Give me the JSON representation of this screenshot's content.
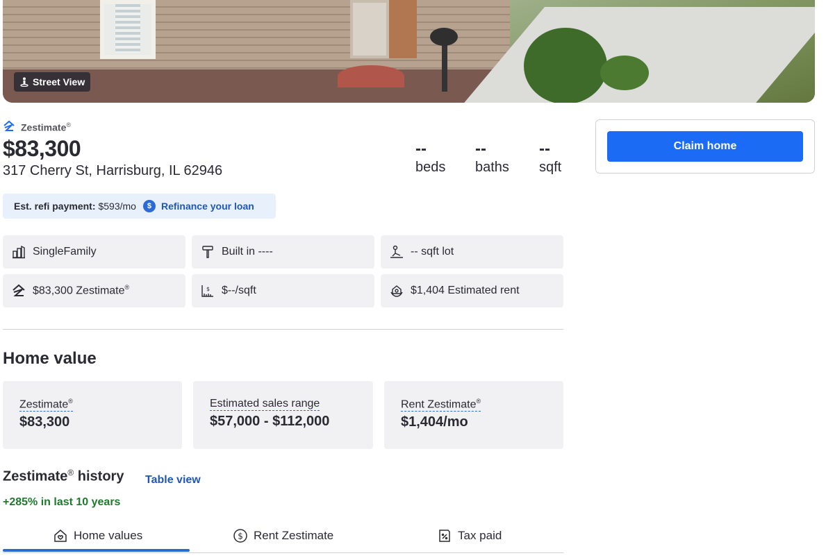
{
  "hero": {
    "street_view_label": "Street View"
  },
  "summary": {
    "zestimate_label": "Zestimate",
    "registered": "®",
    "price": "$83,300",
    "address": "317 Cherry St, Harrisburg, IL 62946",
    "stats": [
      {
        "value": "--",
        "label": "beds"
      },
      {
        "value": "--",
        "label": "baths"
      },
      {
        "value": "--",
        "label": "sqft"
      }
    ]
  },
  "refi": {
    "label": "Est. refi payment:",
    "value": "$593/mo",
    "icon_text": "$",
    "link": "Refinance your loan"
  },
  "facts": [
    {
      "icon": "building-icon",
      "text": "SingleFamily"
    },
    {
      "icon": "hammer-icon",
      "text": "Built in ----"
    },
    {
      "icon": "lot-icon",
      "text": "-- sqft lot"
    },
    {
      "icon": "zillow-logo-icon",
      "text": "$83,300 Zestimate",
      "sup": "®"
    },
    {
      "icon": "price-per-sqft-icon",
      "text": "$--/sqft"
    },
    {
      "icon": "rent-hand-icon",
      "text": "$1,404 Estimated rent"
    }
  ],
  "home_value": {
    "heading": "Home value",
    "cards": [
      {
        "title": "Zestimate",
        "sup": "®",
        "value": "$83,300"
      },
      {
        "title": "Estimated sales range",
        "sup": "",
        "value": "$57,000 - $112,000"
      },
      {
        "title": "Rent Zestimate",
        "sup": "®",
        "value": "$1,404/mo"
      }
    ]
  },
  "history": {
    "heading_prefix": "Zestimate",
    "sup": "®",
    "heading_suffix": " history",
    "table_view": "Table view",
    "growth": "+285% in last 10 years",
    "tabs": [
      {
        "label": "Home values",
        "icon": "home-heart-icon",
        "active": true
      },
      {
        "label": "Rent Zestimate",
        "icon": "dollar-circle-icon",
        "active": false
      },
      {
        "label": "Tax paid",
        "icon": "tax-document-icon",
        "active": false
      }
    ]
  },
  "sidebar": {
    "claim_label": "Claim home"
  },
  "colors": {
    "accent": "#1b6bf5",
    "link": "#1e57b8",
    "growth": "#1f7a2e",
    "card_bg": "#f1f1f4"
  }
}
